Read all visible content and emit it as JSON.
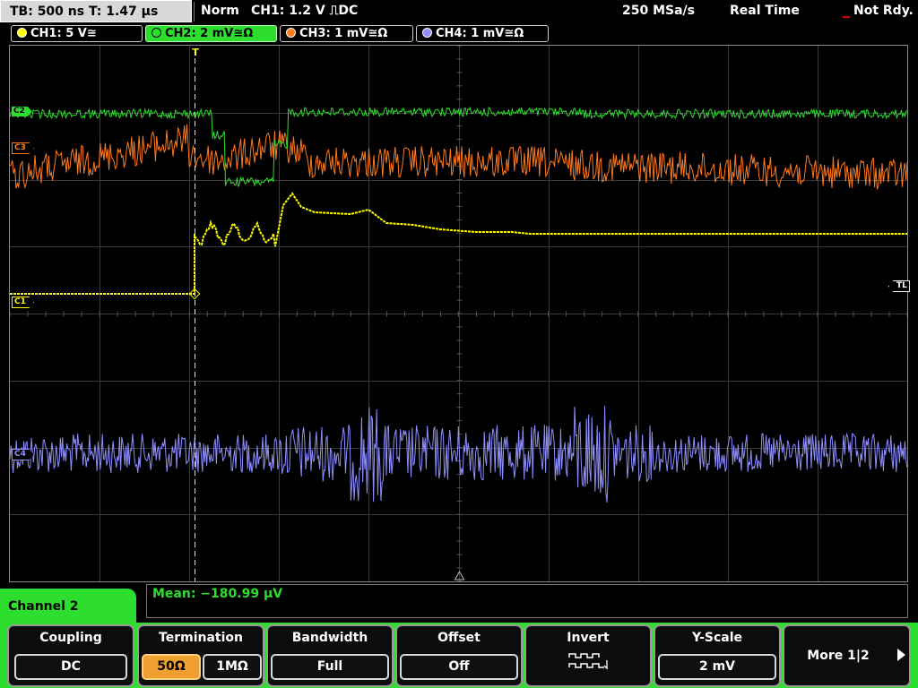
{
  "status_bar": {
    "timebase": "TB: 500 ns   T: 1.47 µs",
    "trigger_mode": "Norm",
    "trigger_info": "CH1: 1.2 V ⎍DC",
    "sample_rate": "250 MSa/s",
    "acq_mode": "Real Time",
    "state": "Not Rdy."
  },
  "channel_tabs": [
    {
      "label": "CH1: 5 V≅",
      "color": "#ffff00"
    },
    {
      "label": "CH2: 2 mV≅Ω",
      "color": "#2ede2e"
    },
    {
      "label": "CH3: 1 mV≅Ω",
      "color": "#ff7a1e"
    },
    {
      "label": "CH4: 1 mV≅Ω",
      "color": "#8f8fff"
    }
  ],
  "markers": {
    "c1": "C1",
    "c2": "C2",
    "c3": "C3",
    "c4": "C4",
    "trigger_level": "TL",
    "trigger_time": "T"
  },
  "measurement": {
    "text": "Mean: −180.99 µV"
  },
  "menu": {
    "title": "Channel 2",
    "coupling": {
      "title": "Coupling",
      "value": "DC"
    },
    "termination": {
      "title": "Termination",
      "options": [
        "50Ω",
        "1MΩ"
      ],
      "selected": "50Ω"
    },
    "bandwidth": {
      "title": "Bandwidth",
      "value": "Full"
    },
    "offset": {
      "title": "Offset",
      "value": "Off"
    },
    "invert": {
      "title": "Invert"
    },
    "yscale": {
      "title": "Y-Scale",
      "value": "2 mV"
    },
    "more": {
      "label": "More 1|2"
    }
  },
  "colors": {
    "ch1": "#ffff00",
    "ch2": "#2ede2e",
    "ch3": "#ff7a1e",
    "ch4": "#8f8fff",
    "trigger": "#ffff00",
    "grid": "#3a3a3a"
  }
}
